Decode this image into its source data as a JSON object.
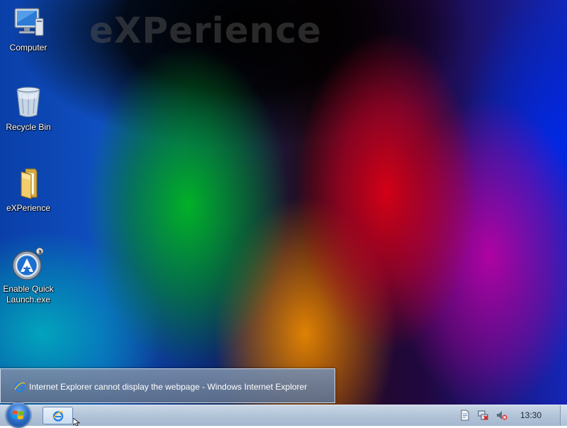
{
  "desktop": {
    "watermark": "eXPerience",
    "icons": [
      {
        "label": "Computer",
        "icon": "computer-icon"
      },
      {
        "label": "Recycle Bin",
        "icon": "recycle-bin-icon"
      },
      {
        "label": "eXPerience",
        "icon": "folder-icon"
      },
      {
        "label": "Enable Quick Launch.exe",
        "icon": "aimp-icon"
      }
    ]
  },
  "notification": {
    "text": "Internet Explorer cannot display the webpage - Windows Internet Explorer",
    "icon": "internet-explorer-icon"
  },
  "taskbar": {
    "start_icon": "windows-start-orb",
    "buttons": [
      {
        "icon": "internet-explorer-icon"
      }
    ],
    "tray_icons": [
      "action-center-icon",
      "network-disconnected-icon",
      "volume-muted-icon"
    ],
    "clock": "13:30"
  }
}
